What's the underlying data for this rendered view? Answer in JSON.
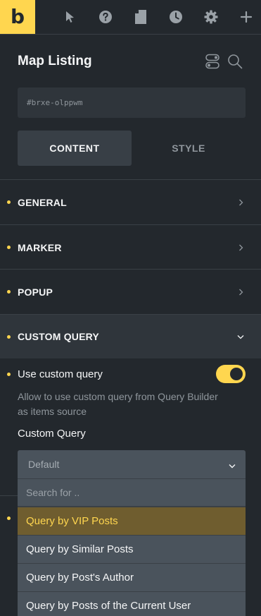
{
  "toolbar": {
    "logo_letter": "b",
    "icons": [
      "cursor-icon",
      "help-icon",
      "page-icon",
      "history-icon",
      "gear-icon",
      "plus-icon"
    ]
  },
  "panel": {
    "title": "Map Listing",
    "element_id": "#brxe-olppwm"
  },
  "tabs": [
    {
      "label": "CONTENT",
      "active": true
    },
    {
      "label": "STYLE",
      "active": false
    }
  ],
  "groups": [
    {
      "label": "GENERAL",
      "expanded": false
    },
    {
      "label": "MARKER",
      "expanded": false
    },
    {
      "label": "POPUP",
      "expanded": false
    },
    {
      "label": "CUSTOM QUERY",
      "expanded": true
    }
  ],
  "custom_query": {
    "toggle_label": "Use custom query",
    "toggle_on": true,
    "description": "Allow to use custom query from Query Builder as items source",
    "field_label": "Custom Query",
    "selected": "Default",
    "search_placeholder": "Search for ..",
    "options": [
      {
        "label": "Query by VIP Posts",
        "highlighted": true
      },
      {
        "label": "Query by Similar Posts",
        "highlighted": false
      },
      {
        "label": "Query by Post's Author",
        "highlighted": false
      },
      {
        "label": "Query by Posts of the Current User",
        "highlighted": false
      }
    ]
  },
  "colors": {
    "accent": "#ffd64f",
    "panel_bg": "#23282d",
    "active_group_bg": "#2f353b"
  }
}
